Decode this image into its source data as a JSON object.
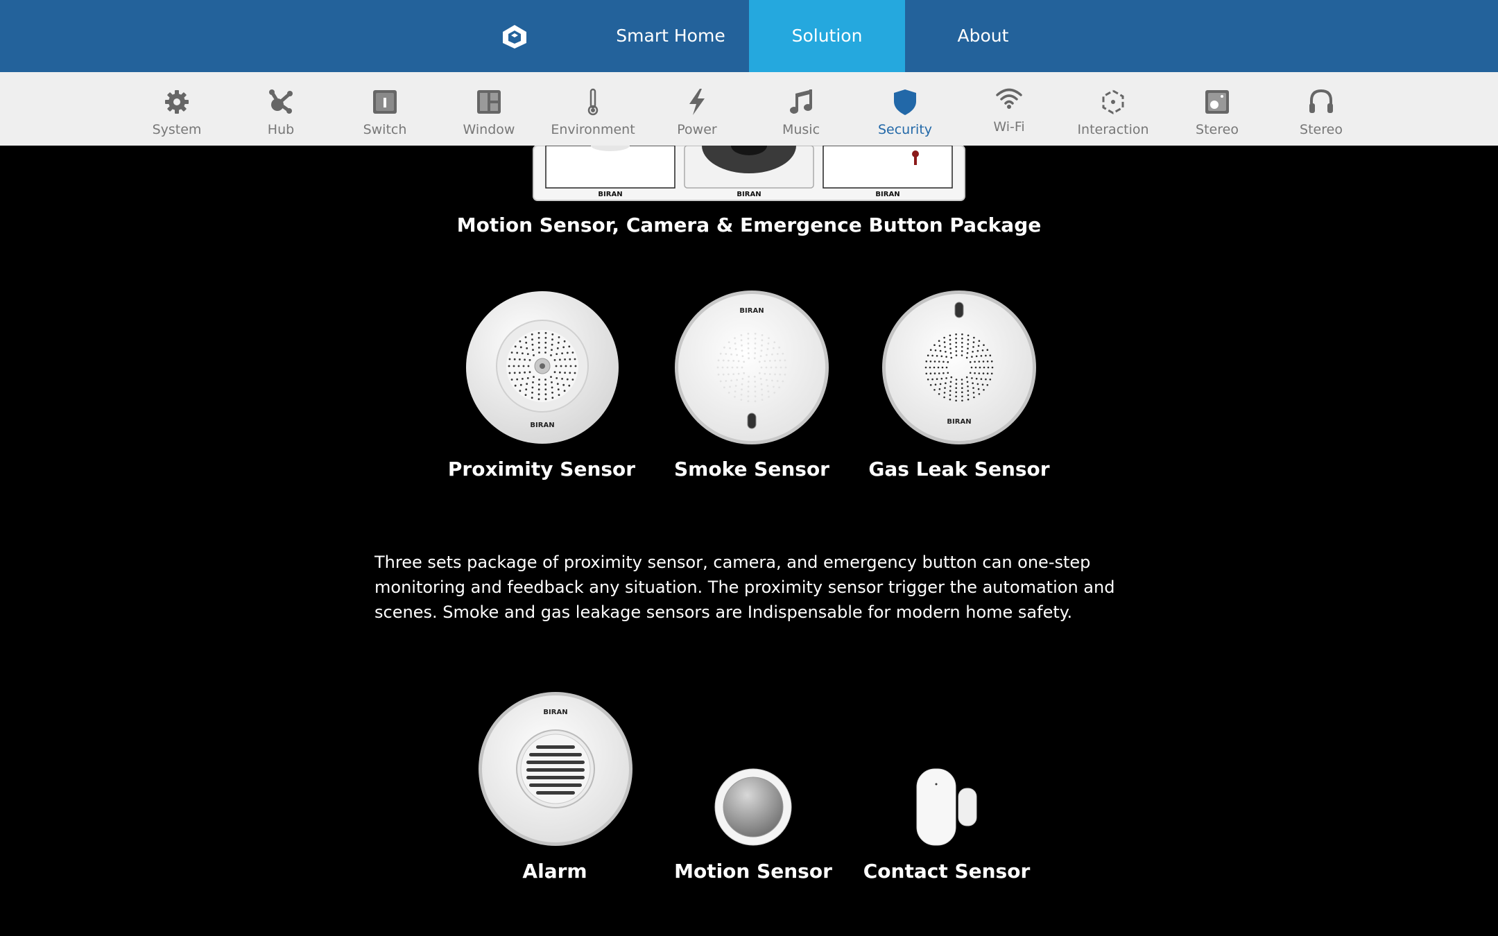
{
  "topnav": {
    "logo_icon": "house-cube-logo",
    "items": [
      {
        "label": "Smart Home",
        "active": false
      },
      {
        "label": "Solution",
        "active": true
      },
      {
        "label": "About",
        "active": false
      }
    ]
  },
  "subnav": {
    "items": [
      {
        "label": "System",
        "icon": "gear-icon"
      },
      {
        "label": "Hub",
        "icon": "hub-icon"
      },
      {
        "label": "Switch",
        "icon": "switch-icon"
      },
      {
        "label": "Window",
        "icon": "window-icon"
      },
      {
        "label": "Environment",
        "icon": "thermometer-icon"
      },
      {
        "label": "Power",
        "icon": "lightning-icon"
      },
      {
        "label": "Music",
        "icon": "music-note-icon"
      },
      {
        "label": "Security",
        "icon": "shield-icon",
        "active": true
      },
      {
        "label": "Wi-Fi",
        "icon": "wifi-icon"
      },
      {
        "label": "Interaction",
        "icon": "interaction-icon"
      },
      {
        "label": "Stereo",
        "icon": "speaker-icon"
      },
      {
        "label": "Stereo",
        "icon": "headphones-icon"
      }
    ]
  },
  "package": {
    "brand_labels": [
      "BIRAN",
      "BIRAN",
      "BIRAN"
    ],
    "caption": "Motion Sensor, Camera & Emergence Button Package"
  },
  "row1": [
    {
      "name": "Proximity Sensor",
      "brand": "BIRAN"
    },
    {
      "name": "Smoke Sensor",
      "brand": "BIRAN"
    },
    {
      "name": "Gas Leak Sensor",
      "brand": "BIRAN"
    }
  ],
  "description": "Three sets package of proximity sensor, camera, and emergency button can one-step monitoring and feedback any situation. The proximity sensor trigger the automation and scenes. Smoke and gas leakage sensors are Indispensable for modern home safety.",
  "row2": [
    {
      "name": "Alarm",
      "brand": "BIRAN"
    },
    {
      "name": "Motion Sensor"
    },
    {
      "name": "Contact Sensor"
    }
  ],
  "colors": {
    "topnav_bg": "#23629b",
    "topnav_active": "#25a8de",
    "subnav_bg": "#efefef",
    "subnav_active_text": "#2268a8",
    "page_bg": "#000000"
  }
}
